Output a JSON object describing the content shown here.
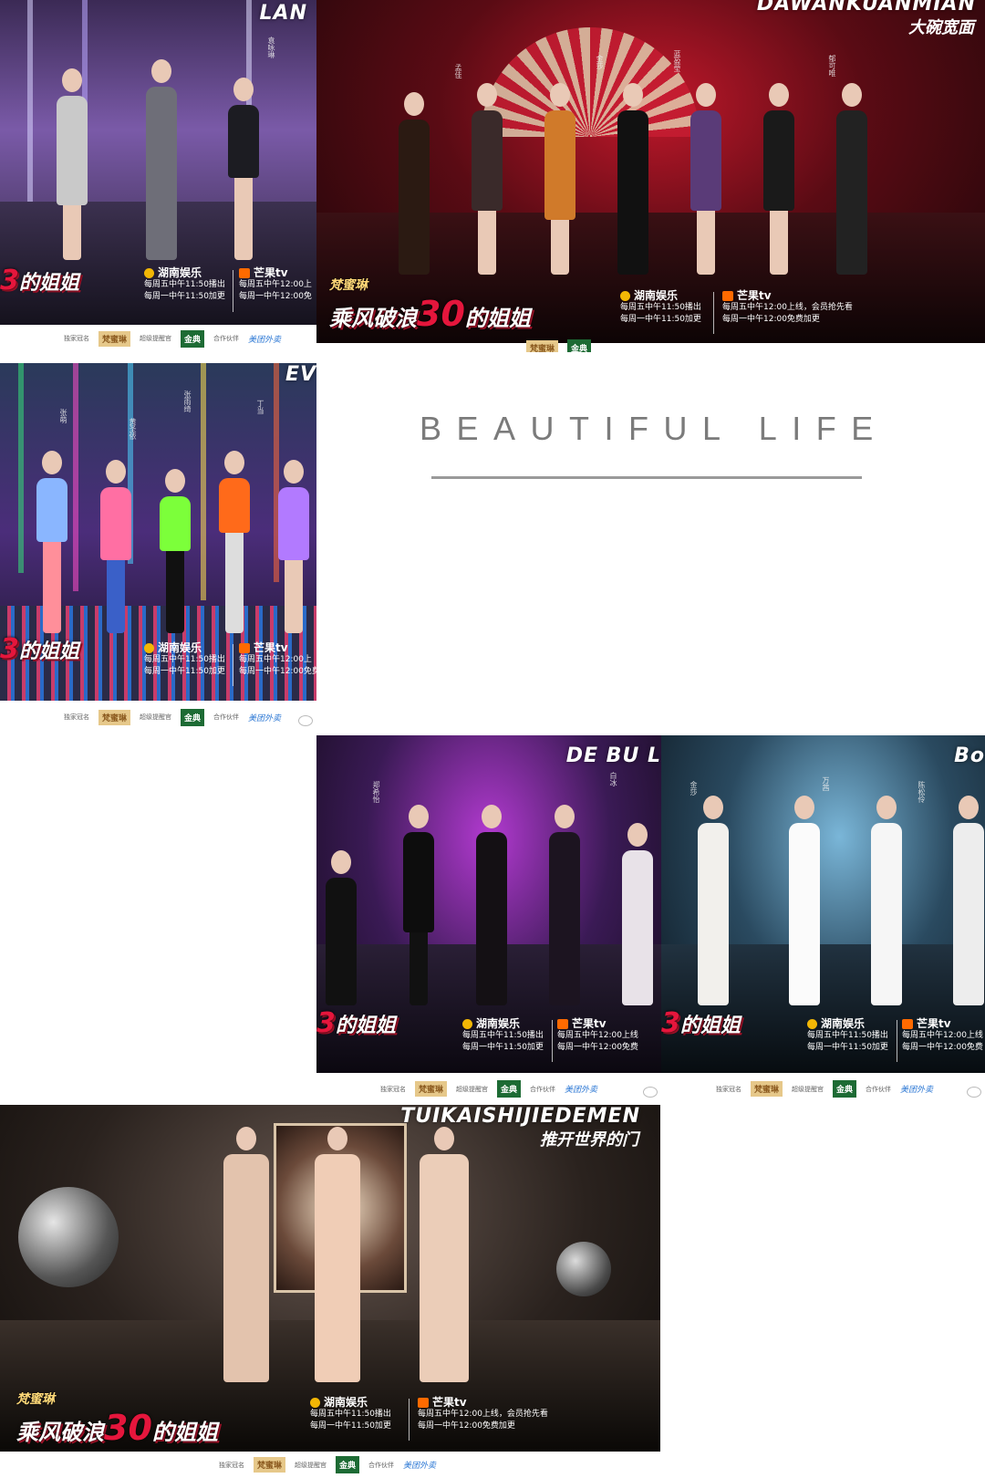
{
  "show": {
    "sponsor": "梵蜜琳",
    "name_part1": "乘风破浪",
    "name_mark": "30",
    "name_part2": "的姐姐",
    "name_cropped": "的姐姐"
  },
  "schedule": {
    "hunan_brand": "湖南娱乐",
    "hunan_line1": "每周五中午11:50播出",
    "hunan_line2": "每周一中午11:50加更",
    "mango_brand": "芒果tv",
    "mango_line1": "每周五中午12:00上线，会员抢先看",
    "mango_line2": "每周一中午12:00免费加更",
    "mango_line1_cropped": "每周五中午12:00上",
    "mango_line1_cropped_b": "每周五中午12:00上线",
    "mango_line2_cropped": "每周一中午12:00免",
    "mango_line2_cropped_b": "每周一中午12:00免费"
  },
  "footer": {
    "sponsor_label": "独家冠名",
    "sponsor_badge": "梵蜜琳",
    "support_label": "超级提醒官",
    "support_badge": "金典",
    "partner_label": "合作伙伴",
    "partner_badge": "美团外卖"
  },
  "posters": {
    "p1_title": "LAN",
    "p2_title": "DAWANKUANMIAN",
    "p2_title_cn": "大碗宽面",
    "p3_title": "EV",
    "p4_title": "DE BU L",
    "p5_title": "Bo",
    "p6_title": "TUIKAISHIJIEDEMEN",
    "p6_title_cn": "推开世界的门"
  },
  "names": {
    "p1": [
      "袁咏琳"
    ],
    "p2": [
      "孟佳",
      "金莎",
      "蓝盈莹",
      "郁可唯",
      "张含韵",
      "王智",
      "伊能静"
    ],
    "p3": [
      "张雨绮",
      "黄圣依",
      "张萌",
      "丁当"
    ],
    "p4": [
      "郑希怡",
      "白冰"
    ],
    "p5": [
      "金莎",
      "万茜",
      "陈松伶"
    ]
  },
  "caption": {
    "text": "BEAUTIFUL LIFE"
  },
  "colors": {
    "accent_red": "#e5163c",
    "caption_gray": "#7b7b7b"
  }
}
